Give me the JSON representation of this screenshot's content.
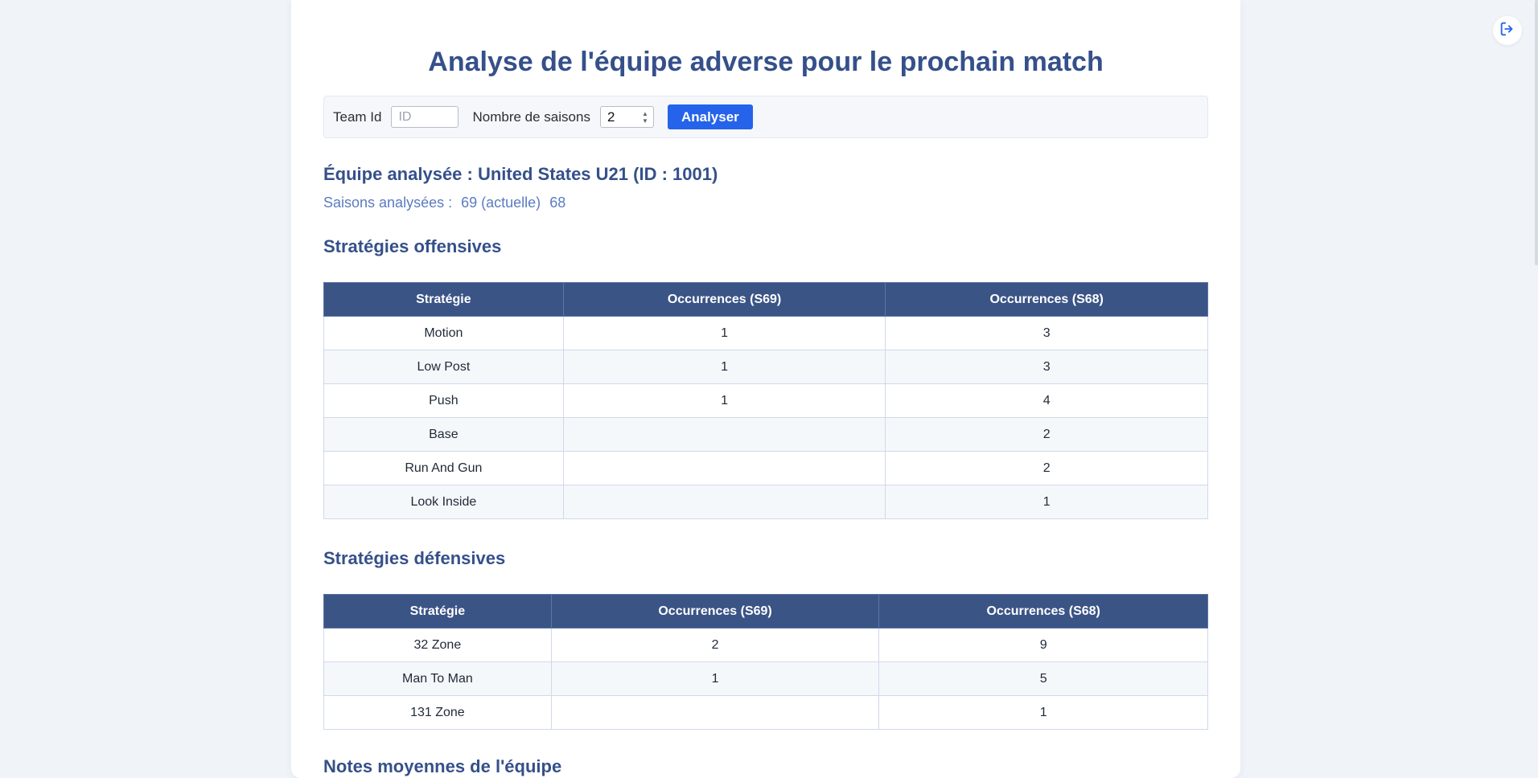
{
  "title": "Analyse de l'équipe adverse pour le prochain match",
  "form": {
    "team_label": "Team Id",
    "team_placeholder": "ID",
    "seasons_label": "Nombre de saisons",
    "seasons_value": "2",
    "submit_label": "Analyser"
  },
  "team": {
    "title": "Équipe analysée : United States U21 (ID : 1001)",
    "seasons_label": "Saisons analysées :",
    "seasons": [
      "69 (actuelle)",
      "68"
    ]
  },
  "offense": {
    "title": "Stratégies offensives",
    "headers": [
      "Stratégie",
      "Occurrences (S69)",
      "Occurrences (S68)"
    ],
    "rows": [
      [
        "Motion",
        "1",
        "3"
      ],
      [
        "Low Post",
        "1",
        "3"
      ],
      [
        "Push",
        "1",
        "4"
      ],
      [
        "Base",
        "",
        "2"
      ],
      [
        "Run And Gun",
        "",
        "2"
      ],
      [
        "Look Inside",
        "",
        "1"
      ]
    ]
  },
  "defense": {
    "title": "Stratégies défensives",
    "headers": [
      "Stratégie",
      "Occurrences (S69)",
      "Occurrences (S68)"
    ],
    "rows": [
      [
        "32 Zone",
        "2",
        "9"
      ],
      [
        "Man To Man",
        "1",
        "5"
      ],
      [
        "131 Zone",
        "",
        "1"
      ]
    ]
  },
  "ratings": {
    "title": "Notes moyennes de l'équipe"
  },
  "icons": {
    "logout": "logout-icon"
  },
  "colors": {
    "accent": "#2563eb",
    "heading": "#35508a",
    "table_header": "#3b5486",
    "background": "#f0f4f9"
  }
}
